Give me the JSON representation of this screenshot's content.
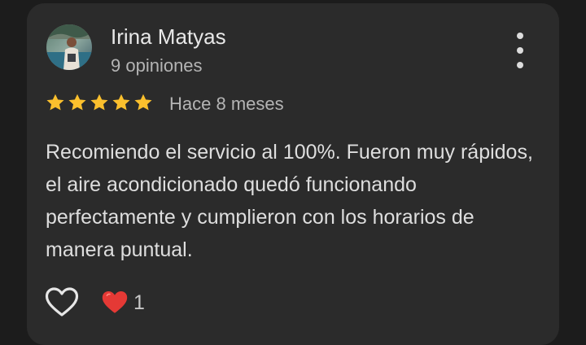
{
  "review": {
    "author_name": "Irina Matyas",
    "author_reviews": "9 opiniones",
    "rating": 5,
    "rating_max": 5,
    "time_ago": "Hace 8 meses",
    "text": "Recomiendo el servicio al 100%. Fueron muy rápidos, el aire acondicionado quedó funcionando perfectamente y cumplieron con los horarios de manera puntual.",
    "reaction_count": "1"
  },
  "icons": {
    "menu": "more-vert-icon",
    "star": "star-icon",
    "like": "heart-outline-icon",
    "reaction": "red-heart-icon"
  },
  "colors": {
    "background": "#1c1c1c",
    "card": "#2b2b2b",
    "star": "#fbc02d",
    "reaction_heart": "#e53935"
  }
}
